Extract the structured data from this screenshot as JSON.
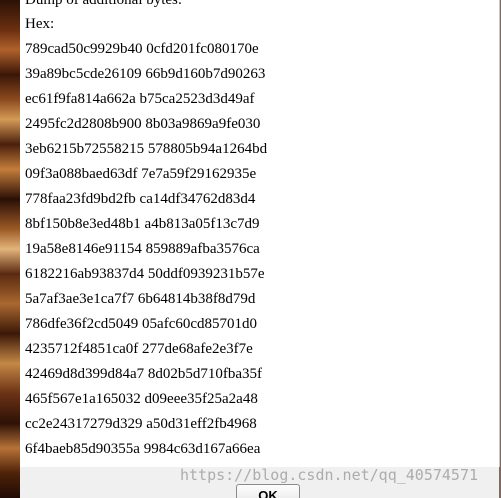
{
  "dialog": {
    "heading": "Dump of additional bytes:",
    "hex_label": "Hex:",
    "hex_lines": [
      "789cad50c9929b40 0cfd201fc080170e",
      "39a89bc5cde26109 66b9d160b7d90263",
      "ec61f9fa814a662a b75ca2523d3d49af",
      "2495fc2d2808b900 8b03a9869a9fe030",
      "3eb6215b72558215 578805b94a1264bd",
      "09f3a088baed63df 7e7a59f29162935e",
      "778faa23fd9bd2fb ca14df34762d83d4",
      "8bf150b8e3ed48b1 a4b813a05f13c7d9",
      "19a58e8146e91154 859889afba3576ca",
      "6182216ab93837d4 50ddf0939231b57e",
      "5a7af3ae3e1ca7f7 6b64814b38f8d79d",
      "786dfe36f2cd5049 05afc60cd85701d0",
      "4235712f4851ca0f 277de68afe2e3f7e",
      "42469d8d399d84a7 8d02b5d710fba35f",
      "465f567e1a165032 d09eee35f25a2a48",
      "cc2e24317279d329 a50d31eff2fb4968",
      "6f4baeb85d90355a 9984c63d167a66ea"
    ],
    "ok_label": "OK"
  },
  "watermark": "https://blog.csdn.net/qq_40574571"
}
